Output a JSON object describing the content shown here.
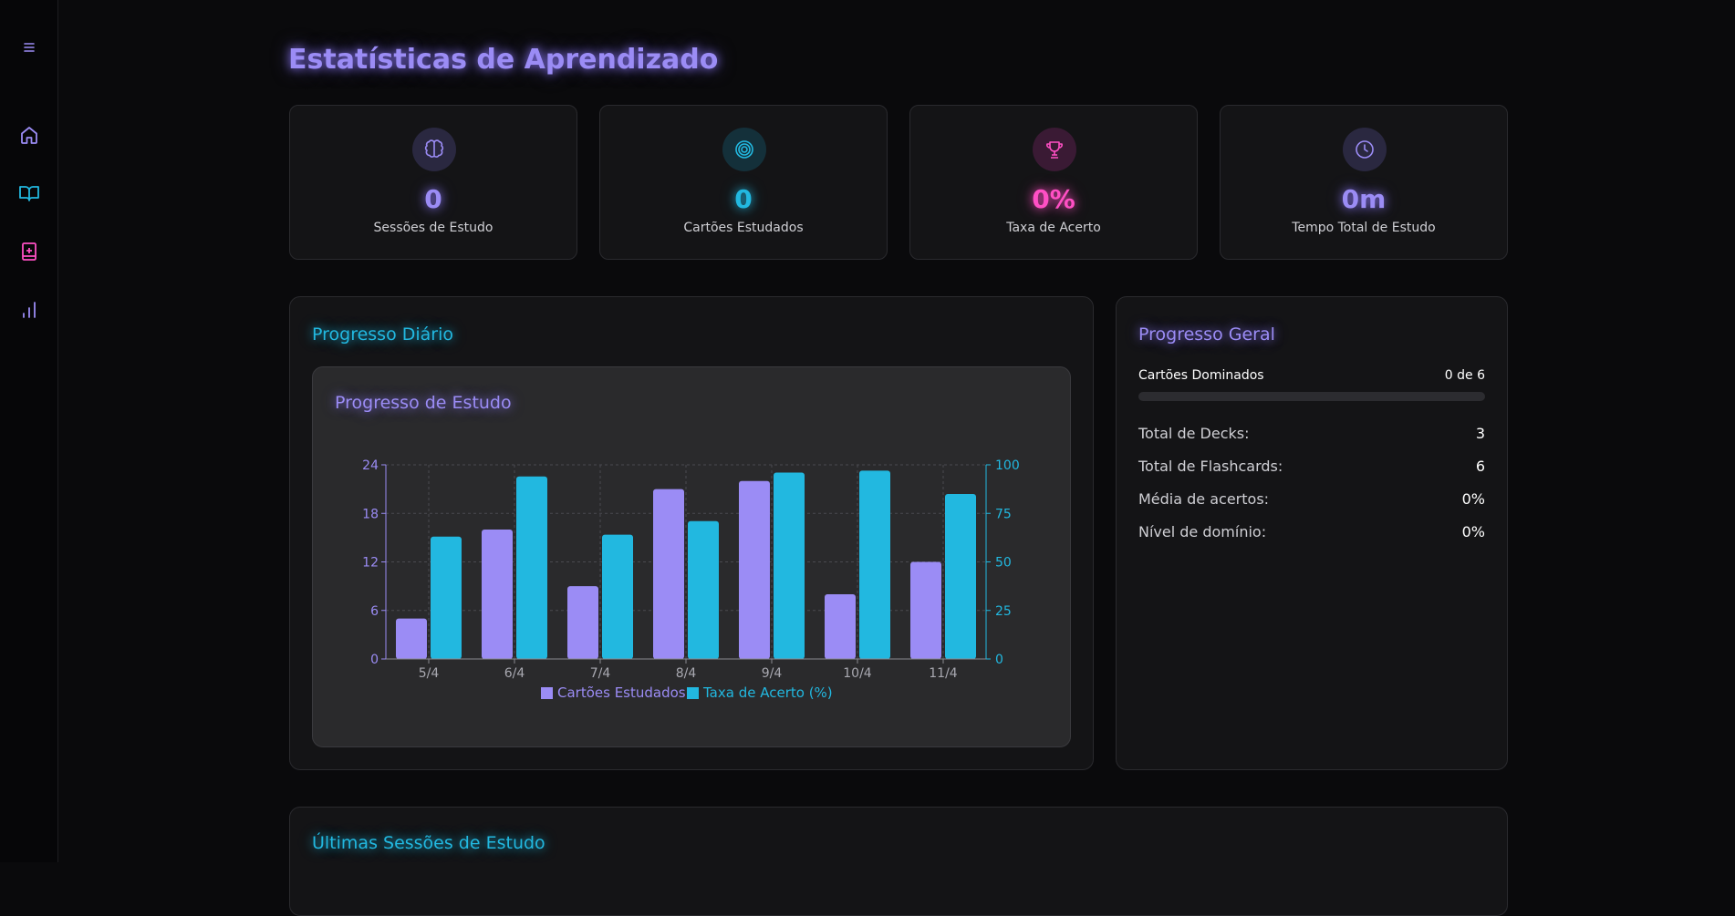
{
  "page": {
    "title": "Estatísticas de Aprendizado"
  },
  "stats": [
    {
      "value": "0",
      "label": "Sessões de Estudo",
      "icon": "brain-icon",
      "color": "#9b8cf5"
    },
    {
      "value": "0",
      "label": "Cartões Estudados",
      "icon": "target-icon",
      "color": "#22b8e0"
    },
    {
      "value": "0%",
      "label": "Taxa de Acerto",
      "icon": "trophy-icon",
      "color": "#ff4fc4"
    },
    {
      "value": "0m",
      "label": "Tempo Total de Estudo",
      "icon": "clock-icon",
      "color": "#9b8cf5"
    }
  ],
  "daily": {
    "title": "Progresso Diário",
    "chart_title": "Progresso de Estudo"
  },
  "overall": {
    "title": "Progresso Geral",
    "mastered_label": "Cartões Dominados",
    "mastered_value": "0 de 6",
    "mastered_fraction": 0,
    "rows": [
      {
        "label": "Total de Decks:",
        "value": "3"
      },
      {
        "label": "Total de Flashcards:",
        "value": "6"
      },
      {
        "label": "Média de acertos:",
        "value": "0%"
      },
      {
        "label": "Nível de domínio:",
        "value": "0%"
      }
    ]
  },
  "sessions": {
    "title": "Últimas Sessões de Estudo"
  },
  "colors": {
    "violet": "#9b8cf5",
    "cyan": "#22b8e0",
    "pink": "#ff4fc4"
  },
  "chart_data": {
    "type": "bar",
    "title": "Progresso de Estudo",
    "categories": [
      "5/4",
      "6/4",
      "7/4",
      "8/4",
      "9/4",
      "10/4",
      "11/4"
    ],
    "series": [
      {
        "name": "Cartões Estudados",
        "axis": "left",
        "values": [
          5,
          16,
          9,
          21,
          22,
          8,
          12
        ]
      },
      {
        "name": "Taxa de Acerto (%)",
        "axis": "right",
        "values": [
          63,
          94,
          64,
          71,
          96,
          97,
          85
        ]
      }
    ],
    "y_left": {
      "ylim": [
        0,
        24
      ],
      "ticks": [
        "0",
        "6",
        "12",
        "18",
        "24"
      ]
    },
    "y_right": {
      "ylim": [
        0,
        100
      ],
      "ticks": [
        "0",
        "25",
        "50",
        "75",
        "100"
      ]
    },
    "grid": true,
    "legend": "bottom"
  }
}
